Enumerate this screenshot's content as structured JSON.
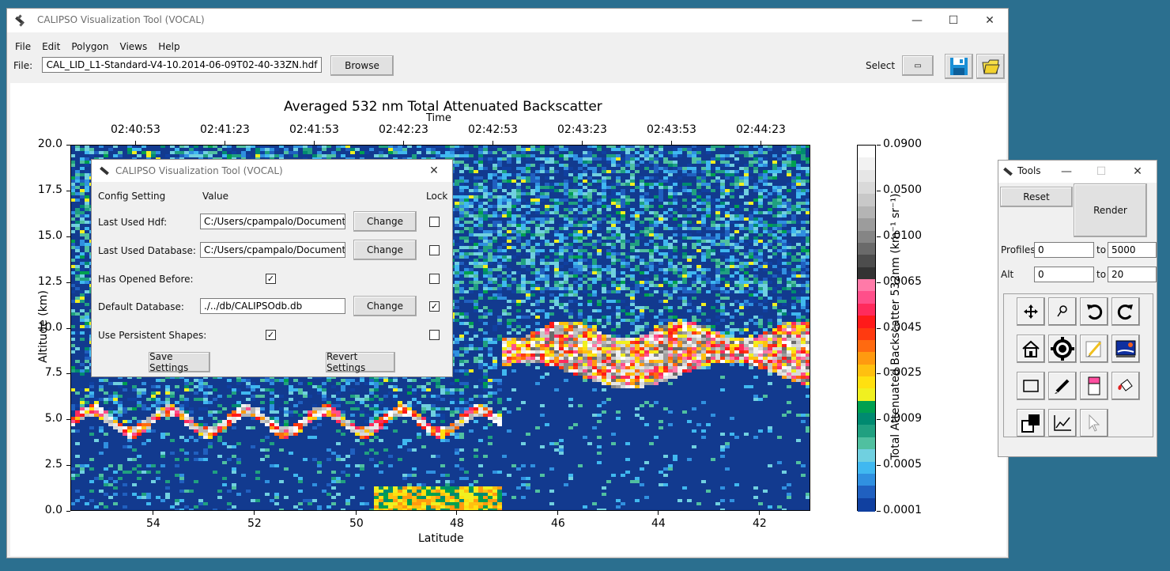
{
  "main_window": {
    "title": "CALIPSO Visualization Tool (VOCAL)",
    "menu": [
      "File",
      "Edit",
      "Polygon",
      "Views",
      "Help"
    ],
    "file_label": "File:",
    "file_value": "CAL_LID_L1-Standard-V4-10.2014-06-09T02-40-33ZN.hdf",
    "browse_label": "Browse",
    "select_label": "Select"
  },
  "plot": {
    "title": "Averaged 532 nm Total Attenuated Backscatter",
    "top_axis_label": "Time",
    "top_ticks": [
      "02:40:53",
      "02:41:23",
      "02:41:53",
      "02:42:23",
      "02:42:53",
      "02:43:23",
      "02:43:53",
      "02:44:23"
    ],
    "y_label": "Altitude (km)",
    "y_ticks": [
      "20.0",
      "17.5",
      "15.0",
      "12.5",
      "10.0",
      "7.5",
      "5.0",
      "2.5",
      "0.0"
    ],
    "x_label": "Latitude",
    "x_ticks": [
      "54",
      "52",
      "50",
      "48",
      "46",
      "44",
      "42"
    ],
    "colorbar_ticks": [
      "0.0900",
      "0.0500",
      "0.0100",
      "0.0065",
      "0.0045",
      "0.0025",
      "0.0009",
      "0.0005",
      "0.0001"
    ],
    "colorbar_label": "Total Attenuated Backscatter 532nm (km⁻¹ sr⁻¹)",
    "colorbar_colors": [
      "#ffffff",
      "#f2f2f2",
      "#e6e6e6",
      "#d9d9d9",
      "#c8c8c8",
      "#b4b4b4",
      "#9c9c9c",
      "#858585",
      "#6a6a6a",
      "#4d4d4d",
      "#333333",
      "#ff7aa8",
      "#ff4f8a",
      "#ff2b5c",
      "#ff1a1a",
      "#ff3a10",
      "#ff6a10",
      "#ff9a10",
      "#ffc010",
      "#ffe010",
      "#f0f020",
      "#00a050",
      "#008a70",
      "#20a080",
      "#50c0a0",
      "#70d0e0",
      "#40b8f0",
      "#3090e0",
      "#2060c0",
      "#1040a0"
    ],
    "chart_data": {
      "type": "heatmap",
      "title": "Averaged 532 nm Total Attenuated Backscatter",
      "xlabel": "Latitude",
      "ylabel": "Altitude (km)",
      "ylim": [
        0,
        20
      ],
      "x_ticks": [
        54,
        52,
        50,
        48,
        46,
        44,
        42
      ],
      "top_xlabel": "Time",
      "top_ticks": [
        "02:40:53",
        "02:41:23",
        "02:41:53",
        "02:42:23",
        "02:42:53",
        "02:43:23",
        "02:43:53",
        "02:44:23"
      ],
      "colorbar_label": "Total Attenuated Backscatter 532nm (km⁻¹ sr⁻¹)",
      "colorbar_ticks": [
        0.09,
        0.05,
        0.01,
        0.0065,
        0.0045,
        0.0025,
        0.0009,
        0.0005,
        0.0001
      ]
    }
  },
  "settings_dialog": {
    "title": "CALIPSO Visualization Tool (VOCAL)",
    "headers": {
      "setting": "Config Setting",
      "value": "Value",
      "lock": "Lock"
    },
    "rows": [
      {
        "label": "Last Used Hdf:",
        "value": "C:/Users/cpampalo/Documents/D",
        "change": "Change",
        "lock": false
      },
      {
        "label": "Last Used Database:",
        "value": "C:/Users/cpampalo/Documents/D",
        "change": "Change",
        "lock": false
      },
      {
        "label": "Has Opened Before:",
        "checked": true,
        "lock": false
      },
      {
        "label": "Default Database:",
        "value": "./../db/CALIPSOdb.db",
        "change": "Change",
        "lock": true
      },
      {
        "label": "Use Persistent Shapes:",
        "checked": true,
        "lock": false
      }
    ],
    "check_mark": "✓",
    "save_label": "Save Settings",
    "revert_label": "Revert Settings"
  },
  "tools_window": {
    "title": "Tools",
    "reset_label": "Reset",
    "render_label": "Render",
    "profiles_label": "Profiles",
    "profiles_from": "0",
    "profiles_to": "5000",
    "to_label": "to",
    "alt_label": "Alt",
    "alt_from": "0",
    "alt_to": "20"
  }
}
